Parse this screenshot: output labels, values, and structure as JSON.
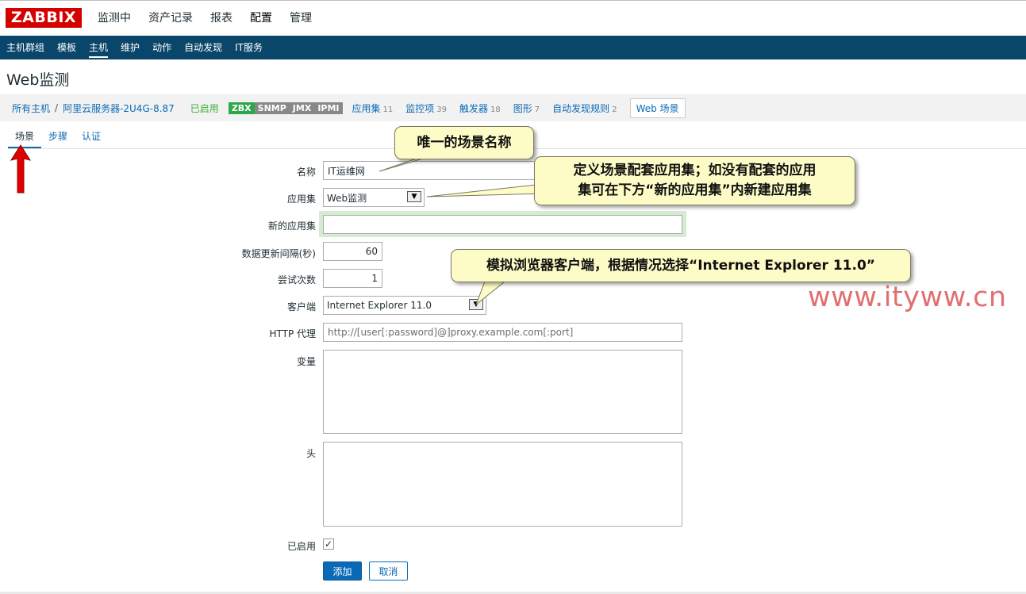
{
  "logo": "ZABBIX",
  "main_nav": [
    {
      "label": "监测中"
    },
    {
      "label": "资产记录"
    },
    {
      "label": "报表"
    },
    {
      "label": "配置"
    },
    {
      "label": "管理"
    }
  ],
  "sub_nav": [
    {
      "label": "主机群组"
    },
    {
      "label": "模板"
    },
    {
      "label": "主机"
    },
    {
      "label": "维护"
    },
    {
      "label": "动作"
    },
    {
      "label": "自动发现"
    },
    {
      "label": "IT服务"
    }
  ],
  "page_title": "Web监测",
  "breadcrumb": {
    "all_hosts": "所有主机",
    "separator": "/",
    "host": "阿里云服务器-2U4G-8.87",
    "status": "已启用",
    "tags": [
      "ZBX",
      "SNMP",
      "JMX",
      "IPMI"
    ],
    "items": [
      {
        "label": "应用集",
        "count": "11"
      },
      {
        "label": "监控项",
        "count": "39"
      },
      {
        "label": "触发器",
        "count": "18"
      },
      {
        "label": "图形",
        "count": "7"
      },
      {
        "label": "自动发现规则",
        "count": "2"
      }
    ],
    "current": "Web 场景"
  },
  "tabs": [
    {
      "label": "场景"
    },
    {
      "label": "步骤"
    },
    {
      "label": "认证"
    }
  ],
  "form": {
    "name_label": "名称",
    "name_value": "IT运维网",
    "app_label": "应用集",
    "app_value": "Web监测",
    "new_app_label": "新的应用集",
    "new_app_value": "",
    "interval_label": "数据更新间隔(秒)",
    "interval_value": "60",
    "attempts_label": "尝试次数",
    "attempts_value": "1",
    "client_label": "客户端",
    "client_value": "Internet Explorer 11.0",
    "proxy_label": "HTTP 代理",
    "proxy_placeholder": "http://[user[:password]@]proxy.example.com[:port]",
    "variables_label": "变量",
    "headers_label": "头",
    "enabled_label": "已启用",
    "enabled_check": "✓",
    "add_button": "添加",
    "cancel_button": "取消"
  },
  "callouts": {
    "name": "唯一的场景名称",
    "app_line1": "定义场景配套应用集；如没有配套的应用",
    "app_line2": "集可在下方“新的应用集”内新建应用集",
    "client": "模拟浏览器客户端，根据情况选择“Internet Explorer 11.0”"
  },
  "watermark": "www.ityww.cn",
  "colors": {
    "logo_red": "#d40000",
    "subnav_blue": "#0a466a",
    "link_blue": "#0a6ab6",
    "enabled_green": "#3ab03a",
    "callout_bg": "#fefcc6",
    "arrow_red": "#e00000"
  }
}
